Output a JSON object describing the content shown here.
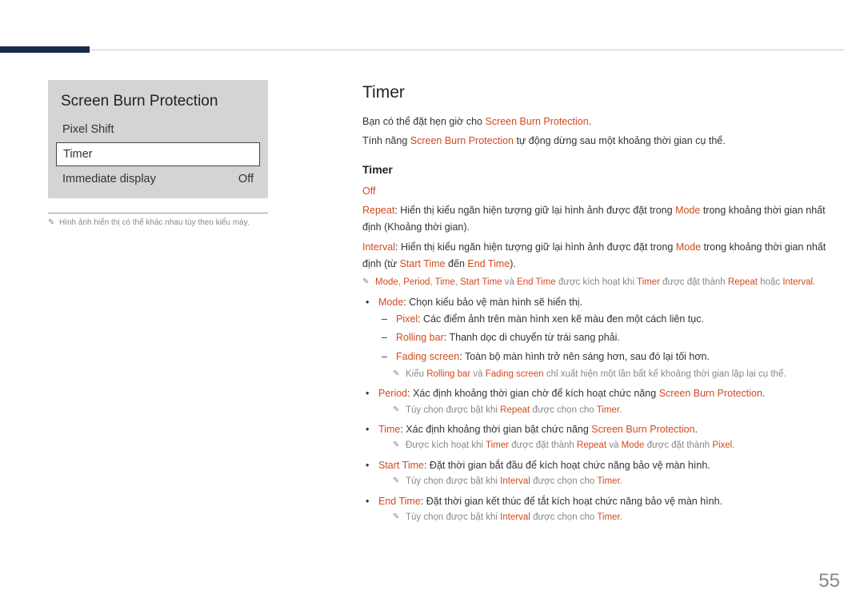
{
  "menu": {
    "title": "Screen Burn Protection",
    "items": [
      {
        "label": "Pixel Shift",
        "value": "",
        "selected": false
      },
      {
        "label": "Timer",
        "value": "",
        "selected": true
      },
      {
        "label": "Immediate display",
        "value": "Off",
        "selected": false
      }
    ],
    "footnote": "Hình ảnh hiển thị có thể khác nhau tùy theo kiểu máy."
  },
  "body": {
    "heading": "Timer",
    "intro1_a": "Bạn có thể đặt hẹn giờ cho ",
    "intro1_b": "Screen Burn Protection",
    "intro1_c": ".",
    "intro2_a": "Tính năng ",
    "intro2_b": "Screen Burn Protection",
    "intro2_c": " tự động dừng sau một khoảng thời gian cụ thể.",
    "sub": "Timer",
    "offLabel": "Off",
    "repeat_a": "Repeat",
    "repeat_b": ": Hiển thị kiểu ngăn hiện tượng giữ lại hình ảnh được đặt trong ",
    "repeat_c": "Mode",
    "repeat_d": " trong khoảng thời gian nhất định (Khoảng thời gian).",
    "interval_a": "Interval",
    "interval_b": ": Hiển thị kiểu ngăn hiện tượng giữ lại hình ảnh được đặt trong ",
    "interval_c": "Mode",
    "interval_d": " trong khoảng thời gian nhất định (từ ",
    "interval_e": "Start Time",
    "interval_f": " đến ",
    "interval_g": "End Time",
    "interval_h": ").",
    "note1_a": "Mode",
    "note1_b": ", ",
    "note1_c": "Period",
    "note1_d": ", ",
    "note1_e": "Time",
    "note1_f": ", ",
    "note1_g": "Start Time",
    "note1_h": " và ",
    "note1_i": "End Time",
    "note1_j": " được kích hoạt khi ",
    "note1_k": "Timer",
    "note1_l": " được đặt thành ",
    "note1_m": "Repeat",
    "note1_n": " hoặc ",
    "note1_o": "Interval",
    "note1_p": ".",
    "mode_a": "Mode",
    "mode_b": ": Chọn kiểu bảo vệ màn hình sẽ hiển thị.",
    "pixel_a": "Pixel",
    "pixel_b": ": Các điểm ảnh trên màn hình xen kẽ màu đen một cách liên tục.",
    "rolling_a": "Rolling bar",
    "rolling_b": ": Thanh dọc di chuyển từ trái sang phải.",
    "fading_a": "Fading screen",
    "fading_b": ": Toàn bộ màn hình trở nên sáng hơn, sau đó lại tối hơn.",
    "note2_a": "Kiểu ",
    "note2_b": "Rolling bar",
    "note2_c": " và ",
    "note2_d": "Fading screen",
    "note2_e": " chỉ xuất hiện một lần bất kể khoảng thời gian lặp lại cụ thể.",
    "period_a": "Period",
    "period_b": ": Xác định khoảng thời gian chờ để kích hoạt chức năng ",
    "period_c": "Screen Burn Protection",
    "period_d": ".",
    "note3_a": "Tùy chọn được bật khi ",
    "note3_b": "Repeat",
    "note3_c": " được chọn cho ",
    "note3_d": "Timer",
    "note3_e": ".",
    "time_a": "Time",
    "time_b": ": Xác định khoảng thời gian bật chức năng ",
    "time_c": "Screen Burn Protection",
    "time_d": ".",
    "note4_a": "Được kích hoạt khi ",
    "note4_b": "Timer",
    "note4_c": " được đặt thành ",
    "note4_d": "Repeat",
    "note4_e": " và ",
    "note4_f": "Mode",
    "note4_g": " được đặt thành ",
    "note4_h": "Pixel",
    "note4_i": ".",
    "start_a": "Start Time",
    "start_b": ": Đặt thời gian bắt đầu để kích hoạt chức năng bảo vệ màn hình.",
    "note5_a": "Tùy chọn được bật khi ",
    "note5_b": "Interval",
    "note5_c": " được chọn cho ",
    "note5_d": "Timer",
    "note5_e": ".",
    "end_a": "End Time",
    "end_b": ": Đặt thời gian kết thúc để tắt kích hoạt chức năng bảo vệ màn hình.",
    "note6_a": "Tùy chọn được bật khi ",
    "note6_b": "Interval",
    "note6_c": " được chọn cho ",
    "note6_d": "Timer",
    "note6_e": "."
  },
  "page": "55"
}
